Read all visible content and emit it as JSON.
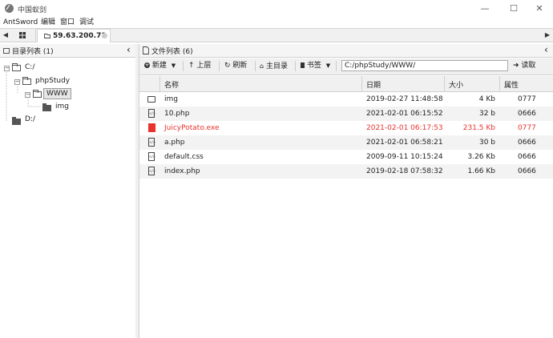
{
  "window": {
    "title": "中国蚁剑",
    "minimize": "—",
    "maximize": "☐",
    "close": "✕"
  },
  "menu": [
    "AntSword",
    "编辑",
    "窗口",
    "调试"
  ],
  "tabs": {
    "left_arrow": "◀",
    "right_arrow": "▶",
    "active_label": "59.63.200.71"
  },
  "left_panel": {
    "title": "目录列表 (1)",
    "collapse": "‹",
    "tree": [
      {
        "label": "C:/",
        "expander": "−"
      },
      {
        "label": "phpStudy",
        "expander": "−"
      },
      {
        "label": "WWW",
        "expander": "−"
      },
      {
        "label": "img",
        "expander": ""
      },
      {
        "label": "D:/",
        "expander": ""
      }
    ]
  },
  "right_panel": {
    "title": "文件列表 (6)",
    "collapse": "‹",
    "toolbar": {
      "new": "新建",
      "up": "上层",
      "refresh": "刷新",
      "home": "主目录",
      "bookmark": "书签",
      "path_value": "C:/phpStudy/WWW/",
      "read": "读取"
    },
    "columns": {
      "name": "名称",
      "date": "日期",
      "size": "大小",
      "attr": "属性"
    },
    "rows": [
      {
        "icon": "folder-icon",
        "name": "img",
        "date": "2019-02-27 11:48:58",
        "size": "4 Kb",
        "attr": "0777",
        "highlight": false
      },
      {
        "icon": "code-file-icon",
        "name": "10.php",
        "date": "2021-02-01 06:15:52",
        "size": "32 b",
        "attr": "0666",
        "highlight": false
      },
      {
        "icon": "executable-file-icon",
        "name": "JuicyPotato.exe",
        "date": "2021-02-01 06:17:53",
        "size": "231.5 Kb",
        "attr": "0777",
        "highlight": true
      },
      {
        "icon": "code-file-icon",
        "name": "a.php",
        "date": "2021-02-01 06:58:21",
        "size": "30 b",
        "attr": "0666",
        "highlight": false
      },
      {
        "icon": "code-file-icon",
        "name": "default.css",
        "date": "2009-09-11 10:15:24",
        "size": "3.26 Kb",
        "attr": "0666",
        "highlight": false
      },
      {
        "icon": "code-file-icon",
        "name": "index.php",
        "date": "2019-02-18 07:58:32",
        "size": "1.66 Kb",
        "attr": "0666",
        "highlight": false
      }
    ]
  },
  "colors": {
    "highlight_text": "#e8332f",
    "accent": "#555555"
  }
}
